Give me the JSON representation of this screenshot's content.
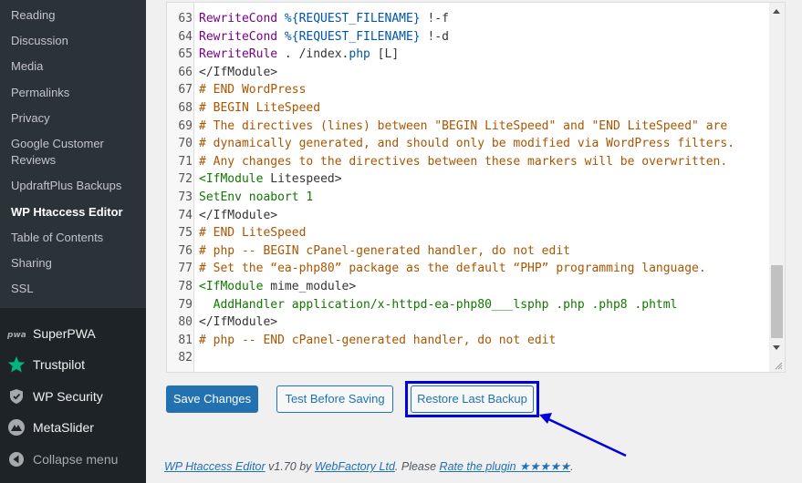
{
  "sidebar": {
    "submenu": [
      {
        "label": "Reading"
      },
      {
        "label": "Discussion"
      },
      {
        "label": "Media"
      },
      {
        "label": "Permalinks"
      },
      {
        "label": "Privacy"
      },
      {
        "label": "Google Customer Reviews"
      },
      {
        "label": "UpdraftPlus Backups"
      },
      {
        "label": "WP Htaccess Editor"
      },
      {
        "label": "Table of Contents"
      },
      {
        "label": "Sharing"
      },
      {
        "label": "SSL"
      }
    ],
    "menu": [
      {
        "label": "SuperPWA",
        "icon": "superpwa-icon"
      },
      {
        "label": "Trustpilot",
        "icon": "star-icon"
      },
      {
        "label": "WP Security",
        "icon": "shield-icon"
      },
      {
        "label": "MetaSlider",
        "icon": "metaslider-icon"
      },
      {
        "label": "Collapse menu",
        "icon": "collapse-icon"
      }
    ]
  },
  "editor": {
    "lines": [
      {
        "n": "63",
        "segs": [
          [
            "kw",
            "RewriteCond "
          ],
          [
            "var",
            "%{REQUEST_FILENAME}"
          ],
          [
            "plain",
            " !-f"
          ]
        ]
      },
      {
        "n": "64",
        "segs": [
          [
            "kw",
            "RewriteCond "
          ],
          [
            "var",
            "%{REQUEST_FILENAME}"
          ],
          [
            "plain",
            " !-d"
          ]
        ]
      },
      {
        "n": "65",
        "segs": [
          [
            "kw",
            "RewriteRule "
          ],
          [
            "plain",
            ". /index."
          ],
          [
            "var",
            "php"
          ],
          [
            "plain",
            " [L]"
          ]
        ]
      },
      {
        "n": "66",
        "segs": [
          [
            "plain",
            "</IfModule>"
          ]
        ]
      },
      {
        "n": "67",
        "segs": [
          [
            "comment",
            "# END WordPress"
          ]
        ]
      },
      {
        "n": "68",
        "segs": [
          [
            "comment",
            "# BEGIN LiteSpeed"
          ]
        ]
      },
      {
        "n": "69",
        "segs": [
          [
            "comment",
            "# The directives (lines) between \"BEGIN LiteSpeed\" and \"END LiteSpeed\" are"
          ]
        ]
      },
      {
        "n": "70",
        "segs": [
          [
            "comment",
            "# dynamically generated, and should only be modified via WordPress filters."
          ]
        ]
      },
      {
        "n": "71",
        "segs": [
          [
            "comment",
            "# Any changes to the directives between these markers will be overwritten."
          ]
        ]
      },
      {
        "n": "72",
        "segs": [
          [
            "tag",
            "<IfModule "
          ],
          [
            "plain",
            "Litespeed>"
          ]
        ]
      },
      {
        "n": "73",
        "segs": [
          [
            "tag",
            "SetEnv noabort 1"
          ]
        ]
      },
      {
        "n": "74",
        "segs": [
          [
            "plain",
            "</IfModule>"
          ]
        ]
      },
      {
        "n": "75",
        "segs": [
          [
            "comment",
            "# END LiteSpeed"
          ]
        ]
      },
      {
        "n": "76",
        "segs": [
          [
            "comment",
            "# php -- BEGIN cPanel-generated handler, do not edit"
          ]
        ]
      },
      {
        "n": "77",
        "segs": [
          [
            "comment",
            "# Set the “ea-php80” package as the default “PHP” programming language."
          ]
        ]
      },
      {
        "n": "78",
        "segs": [
          [
            "tag",
            "<IfModule "
          ],
          [
            "plain",
            "mime_module>"
          ]
        ]
      },
      {
        "n": "79",
        "segs": [
          [
            "tag",
            "  AddHandler application/x-httpd-ea-php80___lsphp .php .php8 .phtml"
          ]
        ]
      },
      {
        "n": "80",
        "segs": [
          [
            "plain",
            "</IfModule>"
          ]
        ]
      },
      {
        "n": "81",
        "segs": [
          [
            "comment",
            "# php -- END cPanel-generated handler, do not edit"
          ]
        ]
      },
      {
        "n": "82",
        "segs": []
      }
    ]
  },
  "buttons": {
    "save": "Save Changes",
    "test": "Test Before Saving",
    "restore": "Restore Last Backup"
  },
  "footer": {
    "plugin": "WP Htaccess Editor",
    "version_by": " v1.70 by ",
    "company": "WebFactory Ltd",
    "please": ". Please ",
    "rate": "Rate the plugin ★★★★★",
    "end": "."
  },
  "colors": {
    "highlight": "#0000dd",
    "primary": "#2271b1",
    "sidebar_bg": "#1d2327"
  }
}
